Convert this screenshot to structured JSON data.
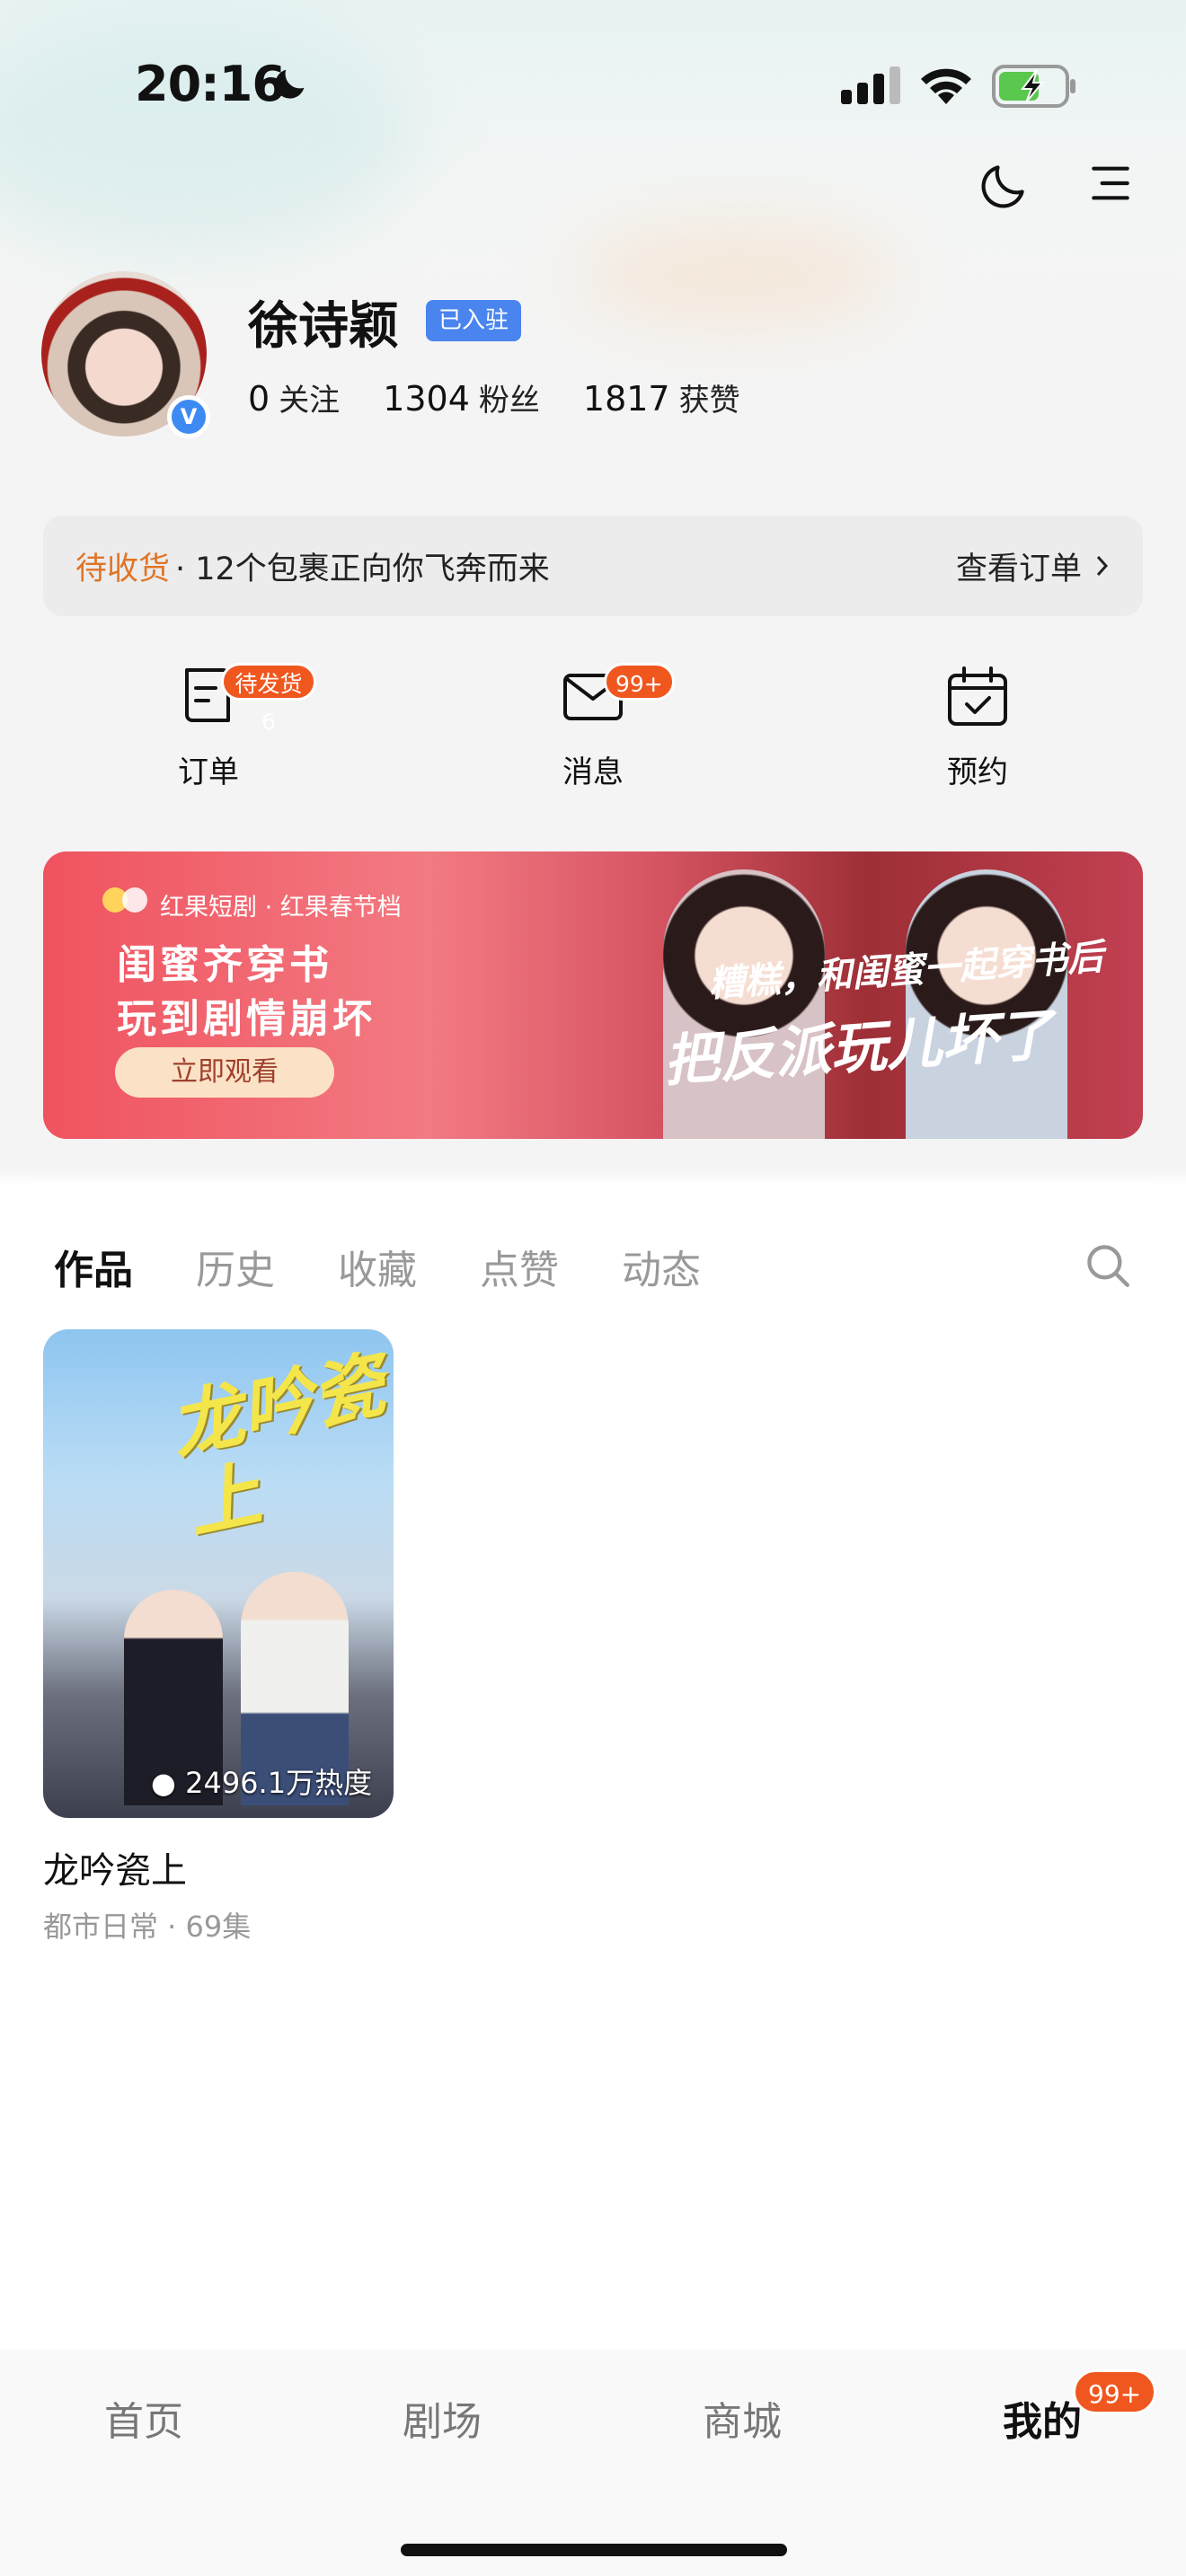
{
  "status_bar": {
    "time": "20:16"
  },
  "profile": {
    "name": "徐诗颖",
    "joined_badge": "已入驻",
    "verified_mark": "V",
    "following_count": "0",
    "following_label": "关注",
    "fans_count": "1304",
    "fans_label": "粉丝",
    "likes_count": "1817",
    "likes_label": "获赞"
  },
  "order_bar": {
    "pending_label": "待收货",
    "message": "· 12个包裹正向你飞奔而来",
    "view_label": "查看订单"
  },
  "quick_actions": [
    {
      "label": "订单",
      "badge": "待发货6",
      "icon": "order-icon"
    },
    {
      "label": "消息",
      "badge": "99+",
      "icon": "mail-icon"
    },
    {
      "label": "预约",
      "badge": "",
      "icon": "calendar-icon"
    }
  ],
  "banner": {
    "brand": "红果短剧 · 红果春节档",
    "line1": "闺蜜齐穿书",
    "line2": "玩到剧情崩坏",
    "button": "立即观看",
    "slogan1": "糟糕，和闺蜜一起穿书后",
    "slogan2": "把反派玩儿坏了"
  },
  "tabs": [
    {
      "label": "作品",
      "active": true
    },
    {
      "label": "历史",
      "active": false
    },
    {
      "label": "收藏",
      "active": false
    },
    {
      "label": "点赞",
      "active": false
    },
    {
      "label": "动态",
      "active": false
    }
  ],
  "works": [
    {
      "poster_title": "龙吟瓷上",
      "heat": "2496.1万热度",
      "title": "龙吟瓷上",
      "subtitle": "都市日常 · 69集"
    }
  ],
  "tab_bar": {
    "items": [
      {
        "label": "首页",
        "active": false
      },
      {
        "label": "剧场",
        "active": false
      },
      {
        "label": "商城",
        "active": false
      },
      {
        "label": "我的",
        "active": true
      }
    ],
    "badge": "99+"
  },
  "colors": {
    "accent_orange": "#e07427",
    "badge_red": "#f0571f",
    "verified_blue": "#3d8bf2"
  }
}
